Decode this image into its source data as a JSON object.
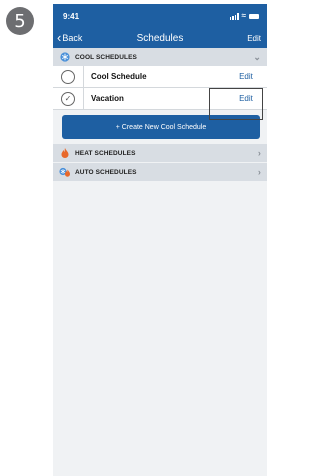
{
  "step": "5",
  "status_bar": {
    "time": "9:41"
  },
  "nav": {
    "back_label": "Back",
    "title": "Schedules",
    "edit_label": "Edit"
  },
  "cool": {
    "header": "COOL SCHEDULES",
    "schedules": [
      {
        "name": "Cool Schedule",
        "edit_label": "Edit",
        "selected": false
      },
      {
        "name": "Vacation",
        "edit_label": "Edit",
        "selected": true
      }
    ],
    "create_button": "+ Create New Cool Schedule"
  },
  "heat": {
    "header": "HEAT SCHEDULES"
  },
  "auto": {
    "header": "AUTO SCHEDULES"
  },
  "colors": {
    "primary": "#1e5fa2",
    "section_bg": "#d8dde3",
    "cool_icon": "#4a90d9",
    "heat_icon": "#e8682a"
  }
}
